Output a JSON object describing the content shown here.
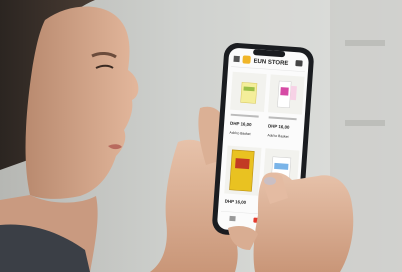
{
  "phone": {
    "app_title": "EUN STORE",
    "products": [
      {
        "price": "DHP 16,00",
        "action": "Add to Basket"
      },
      {
        "price": "DHP 16,00",
        "action": "Add to Basket"
      },
      {
        "price": "DHP 16,00",
        "action": ""
      }
    ]
  },
  "colors": {
    "app_accent": "#f0b528",
    "app_header": "#e84b3c",
    "nav_active": "#e53a2e",
    "background_wall": "#c7c9c6",
    "phone_body": "#1a1c20"
  },
  "icons": [
    "menu-icon",
    "cart-icon",
    "home-icon",
    "bag-icon",
    "user-icon"
  ]
}
